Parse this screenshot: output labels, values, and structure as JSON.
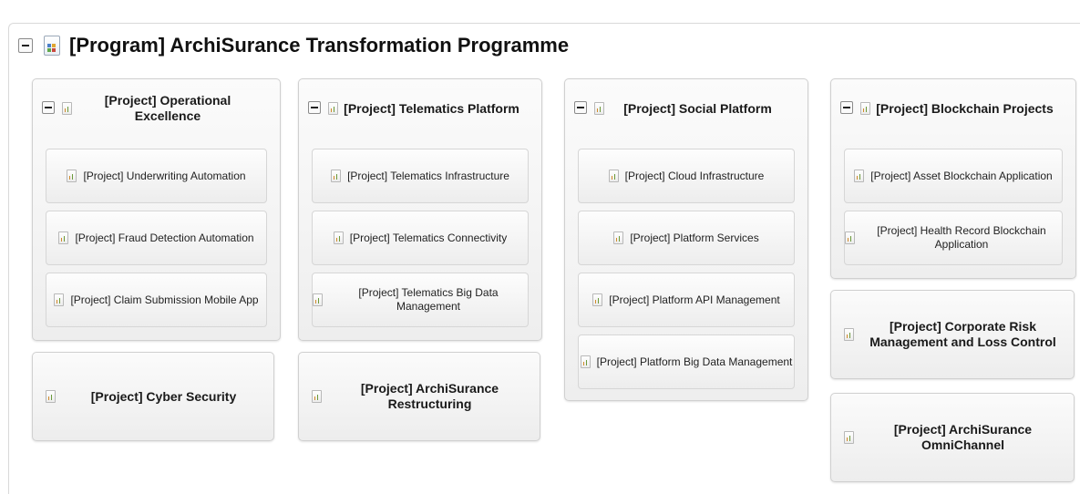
{
  "program": {
    "title": "[Program] ArchiSurance Transformation Programme"
  },
  "groups": [
    {
      "title": "[Project] Operational Excellence",
      "items": [
        "[Project] Underwriting Automation",
        "[Project] Fraud Detection Automation",
        "[Project] Claim Submission Mobile App"
      ]
    },
    {
      "title": "[Project] Telematics Platform",
      "items": [
        "[Project] Telematics Infrastructure",
        "[Project] Telematics Connectivity",
        "[Project] Telematics Big Data Management"
      ]
    },
    {
      "title": "[Project] Social Platform",
      "items": [
        "[Project] Cloud Infrastructure",
        "[Project] Platform Services",
        "[Project] Platform API Management",
        "[Project] Platform Big Data Management"
      ]
    },
    {
      "title": "[Project] Blockchain Projects",
      "items": [
        "[Project] Asset Blockchain Application",
        "[Project] Health Record Blockchain Application"
      ]
    }
  ],
  "leaves": [
    "[Project] Cyber Security",
    "[Project] ArchiSurance Restructuring",
    "[Project] Corporate Risk Management and Loss Control",
    "[Project] ArchiSurance OmniChannel"
  ]
}
